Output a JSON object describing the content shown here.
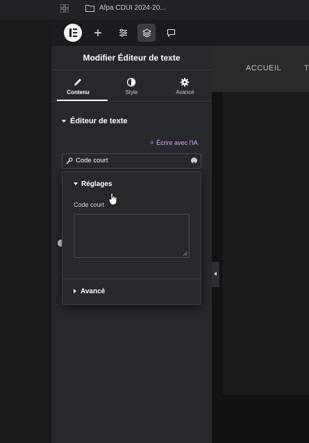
{
  "topbar": {
    "tab_title": "Afpa CDUI 2024-20..."
  },
  "toolbar": {
    "logo_icon": "elementor-logo-icon",
    "add_icon": "plus-icon",
    "settings_icon": "sliders-icon",
    "structure_icon": "layers-icon",
    "comments_icon": "comment-icon"
  },
  "panel": {
    "title": "Modifier Éditeur de texte",
    "tabs": [
      {
        "label": "Contenu",
        "icon": "pencil-icon",
        "active": true
      },
      {
        "label": "Style",
        "icon": "half-circle-icon",
        "active": false
      },
      {
        "label": "Avancé",
        "icon": "gear-icon",
        "active": false
      }
    ],
    "section_title": "Éditeur de texte",
    "ai_link": "Écrire avec l'IA",
    "shortcode_field": "Code court"
  },
  "popover": {
    "section_title": "Réglages",
    "field_label": "Code court",
    "textarea_value": "",
    "advanced_title": "Avancé"
  },
  "canvas": {
    "nav_accueil": "ACCUEIL",
    "nav_next": "T"
  },
  "colors": {
    "panel_bg": "#26282c",
    "accent_ai": "#d9a9ff",
    "toolbar_bg": "#1a1b1e"
  }
}
